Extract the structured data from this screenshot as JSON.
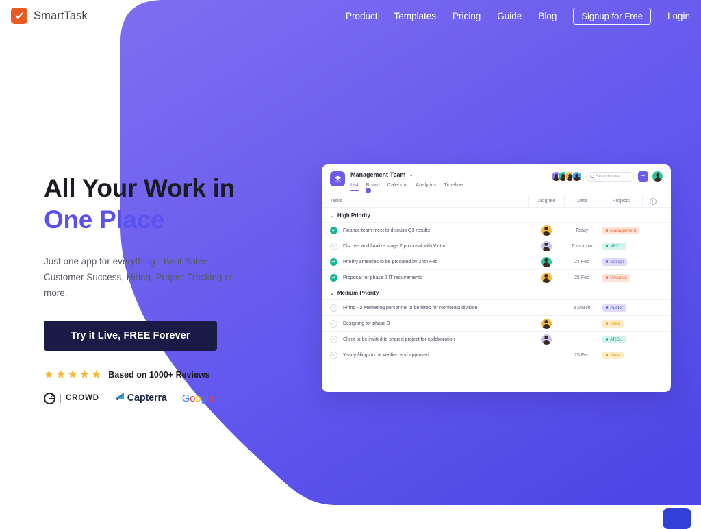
{
  "brand": {
    "name": "SmartTask",
    "mark_icon": "checkmark-icon",
    "mark_color": "#ec5a23"
  },
  "nav": {
    "items": [
      "Product",
      "Templates",
      "Pricing",
      "Guide",
      "Blog"
    ],
    "signup_label": "Signup for Free",
    "login_label": "Login"
  },
  "hero": {
    "heading_line1": "All Your Work in",
    "heading_line2": "One Place",
    "accent_color": "#5b50f0",
    "subtitle": "Just one app for everything - Be it Sales, Customer Success, Hiring, Project Tracking or more.",
    "cta_label": "Try it Live, FREE Forever",
    "cta_color": "#191a46",
    "stars": "★★★★★",
    "rating_text": "Based on 1000+ Reviews",
    "review_logos": [
      {
        "name": "g2-crowd",
        "sup": "2",
        "word": "CROWD"
      },
      {
        "name": "capterra",
        "word": "Capterra"
      },
      {
        "name": "google",
        "letters": [
          "G",
          "o",
          "o",
          "g",
          "l",
          "e"
        ]
      }
    ]
  },
  "app": {
    "workspace": "Management Team",
    "logo_icon": "layers-icon",
    "tabs": [
      {
        "label": "List",
        "active": true
      },
      {
        "label": "Board",
        "active": false
      },
      {
        "label": "Calendar",
        "active": false
      },
      {
        "label": "Analytics",
        "active": false
      },
      {
        "label": "Timeline",
        "active": false
      }
    ],
    "search_placeholder": "Search here...",
    "add_label": "+",
    "member_avatars": [
      "#8e7ff0",
      "#2fc39b",
      "#f4b73f",
      "#4aa8e8"
    ],
    "current_user_avatar": "#2fc39b",
    "columns": {
      "tasks": "Tasks",
      "assignee": "Asignee",
      "date": "Date",
      "projects": "Projects"
    },
    "groups": [
      {
        "title": "High Priority",
        "rows": [
          {
            "done": true,
            "task": "Finance team meet to discuss Q3 results",
            "avatar": "#f4b73f",
            "date": "Today",
            "tag": "Management",
            "tag_bg": "#fde2d7",
            "tag_fg": "#ef6c3e",
            "dot": "#ef6c3e"
          },
          {
            "done": false,
            "task": "Discuss and finalize stage 2 proposal with Victor",
            "avatar": "#c6c2ef",
            "date": "Tomorrow",
            "tag": "ARCU",
            "tag_bg": "#d5f3ec",
            "tag_fg": "#17a98c",
            "dot": "#17a98c"
          },
          {
            "done": true,
            "task": "Priority amenties to be procured by 24th Feb",
            "avatar": "#2fc39b",
            "date": "24 Feb",
            "tag": "Design",
            "tag_bg": "#dedbfa",
            "tag_fg": "#6c5ce7",
            "dot": "#6c5ce7"
          },
          {
            "done": true,
            "task": "Proposal for phase 2 IT requirements",
            "avatar": "#f4b73f",
            "date": "25 Feb",
            "tag": "Vivamus",
            "tag_bg": "#fde2d7",
            "tag_fg": "#ef6c3e",
            "dot": "#ef6c3e"
          }
        ]
      },
      {
        "title": "Medium Priority",
        "rows": [
          {
            "done": false,
            "task": "Hiring - 2 Marketing personnel to be hired for Northeast division",
            "avatar": "",
            "date": "3 March",
            "tag": "Auctor",
            "tag_bg": "#dedbfa",
            "tag_fg": "#4a55d6",
            "dot": "#4a55d6"
          },
          {
            "done": false,
            "task": "Designing for phase 3",
            "avatar": "#f4b73f",
            "date": "-",
            "tag": "Vitae",
            "tag_bg": "#fcecc8",
            "tag_fg": "#e0a21b",
            "dot": "#e0a21b"
          },
          {
            "done": false,
            "task": "Client to be invited to shared project for collaboration",
            "avatar": "#c6c2ef",
            "date": "-",
            "tag": "ARCU",
            "tag_bg": "#d5f3ec",
            "tag_fg": "#17a98c",
            "dot": "#17a98c"
          },
          {
            "done": false,
            "task": "Yearly filings to be verified and approved",
            "avatar": "",
            "date": "25 Feb",
            "tag": "Vitae",
            "tag_bg": "#fcecc8",
            "tag_fg": "#e0a21b",
            "dot": "#e0a21b"
          }
        ]
      }
    ]
  },
  "decor": {
    "blob_color_top": "#7b6cf0",
    "blob_color_bottom": "#4f46e5",
    "chat_color": "#3040d8"
  }
}
